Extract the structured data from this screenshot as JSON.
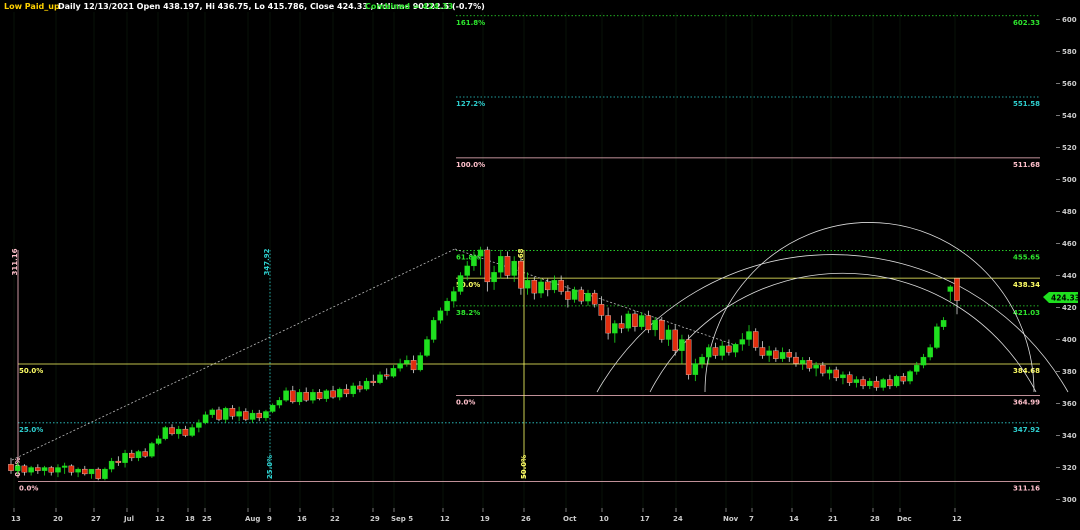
{
  "header": {
    "symbol": "Low Paid_up",
    "info": "Daily 12/13/2021 Open 438.197, Hi 436.75, Lo 415.786, Close 424.33 , Volume 90222.5 (-0.7%)",
    "combined": "Combined = 424.33"
  },
  "colors": {
    "background": "#000000",
    "up_candle": "#1fe01f",
    "down_candle": "#e02e0e",
    "last_price_tag": "#1fe01f"
  },
  "chart_data": {
    "type": "candlestick",
    "title": "",
    "ylim": [
      290,
      610
    ],
    "y_ticks": [
      300,
      320,
      340,
      360,
      380,
      400,
      420,
      440,
      460,
      480,
      500,
      520,
      540,
      560,
      580,
      600
    ],
    "x_ticks": [
      "13",
      "20",
      "27",
      "Jul",
      "12",
      "18",
      "25",
      "Aug",
      "9",
      "16",
      "22",
      "29",
      "Sep 5",
      "12",
      "19",
      "26",
      "Oct",
      "10",
      "17",
      "24",
      "Nov",
      "7",
      "14",
      "21",
      "28",
      "Dec",
      "12"
    ],
    "last_price": "424.33",
    "levels_right": [
      {
        "pct": "161.8%",
        "value": "602.33",
        "price": 602.33,
        "style": "dotted",
        "color": "#2ee62e"
      },
      {
        "pct": "127.2%",
        "value": "551.58",
        "price": 551.58,
        "style": "dotted",
        "color": "#2ecfcf"
      },
      {
        "pct": "100.0%",
        "value": "511.68",
        "price": 513.5,
        "style": "solid",
        "color": "#ffc0cb"
      },
      {
        "pct": "61.8%",
        "value": "455.65",
        "price": 455.65,
        "style": "dotted",
        "color": "#2ee62e"
      },
      {
        "pct": "50.0%",
        "value": "438.34",
        "price": 438.34,
        "style": "solid",
        "color": "#ffff66"
      },
      {
        "pct": "38.2%",
        "value": "421.03",
        "price": 421.03,
        "style": "dotted",
        "color": "#2ee62e"
      },
      {
        "pct": "0.0%",
        "value": "364.99",
        "price": 364.99,
        "style": "solid",
        "color": "#ffc0cb"
      }
    ],
    "levels_left": [
      {
        "pct": "50.0%",
        "price": 384.68,
        "style": "solid",
        "color": "#ffff66"
      },
      {
        "pct": "25.0%",
        "price": 347.92,
        "style": "dotted",
        "color": "#2ecfcf"
      },
      {
        "pct": "0.0%",
        "price": 311.16,
        "style": "solid",
        "color": "#ffc0cb"
      }
    ],
    "right_levels_extra": [
      {
        "value": "384.68",
        "price": 384.68,
        "color": "#ffff66"
      },
      {
        "value": "347.92",
        "price": 347.92,
        "color": "#2ecfcf"
      },
      {
        "value": "311.16",
        "price": 311.16,
        "color": "#ffc0cb"
      }
    ],
    "vertical_markers": [
      {
        "label": "311.16",
        "date": "13",
        "color": "#ffc0cb",
        "bottom_label": "0.0%"
      },
      {
        "label": "347.92",
        "date": "9",
        "color": "#2ecfcf",
        "bottom_label": "25.0%"
      },
      {
        "label": "384.68",
        "date": "26",
        "color": "#ffff66",
        "bottom_label": "50.0%"
      }
    ],
    "candles": [
      {
        "o": 322,
        "h": 326,
        "l": 316,
        "c": 318
      },
      {
        "o": 318,
        "h": 323,
        "l": 316,
        "c": 321
      },
      {
        "o": 321,
        "h": 322,
        "l": 315,
        "c": 317
      },
      {
        "o": 317,
        "h": 321,
        "l": 315,
        "c": 320
      },
      {
        "o": 320,
        "h": 322,
        "l": 316,
        "c": 318
      },
      {
        "o": 318,
        "h": 321,
        "l": 315,
        "c": 320
      },
      {
        "o": 320,
        "h": 321,
        "l": 315,
        "c": 317
      },
      {
        "o": 317,
        "h": 322,
        "l": 314,
        "c": 320
      },
      {
        "o": 320,
        "h": 323,
        "l": 316,
        "c": 321
      },
      {
        "o": 321,
        "h": 322,
        "l": 315,
        "c": 317
      },
      {
        "o": 317,
        "h": 320,
        "l": 314,
        "c": 319
      },
      {
        "o": 319,
        "h": 321,
        "l": 315,
        "c": 316
      },
      {
        "o": 316,
        "h": 319,
        "l": 313,
        "c": 319
      },
      {
        "o": 319,
        "h": 320,
        "l": 312,
        "c": 313
      },
      {
        "o": 313,
        "h": 320,
        "l": 312,
        "c": 319
      },
      {
        "o": 319,
        "h": 326,
        "l": 317,
        "c": 324
      },
      {
        "o": 324,
        "h": 327,
        "l": 321,
        "c": 323
      },
      {
        "o": 323,
        "h": 331,
        "l": 320,
        "c": 329
      },
      {
        "o": 329,
        "h": 331,
        "l": 324,
        "c": 326
      },
      {
        "o": 326,
        "h": 331,
        "l": 324,
        "c": 330
      },
      {
        "o": 330,
        "h": 332,
        "l": 326,
        "c": 327
      },
      {
        "o": 327,
        "h": 336,
        "l": 326,
        "c": 335
      },
      {
        "o": 335,
        "h": 340,
        "l": 334,
        "c": 338
      },
      {
        "o": 338,
        "h": 346,
        "l": 337,
        "c": 345
      },
      {
        "o": 345,
        "h": 347,
        "l": 340,
        "c": 341
      },
      {
        "o": 341,
        "h": 346,
        "l": 338,
        "c": 344
      },
      {
        "o": 344,
        "h": 346,
        "l": 339,
        "c": 340
      },
      {
        "o": 340,
        "h": 347,
        "l": 339,
        "c": 345
      },
      {
        "o": 345,
        "h": 350,
        "l": 342,
        "c": 348
      },
      {
        "o": 348,
        "h": 355,
        "l": 347,
        "c": 353
      },
      {
        "o": 353,
        "h": 357,
        "l": 351,
        "c": 356
      },
      {
        "o": 356,
        "h": 358,
        "l": 349,
        "c": 350
      },
      {
        "o": 350,
        "h": 358,
        "l": 348,
        "c": 357
      },
      {
        "o": 357,
        "h": 359,
        "l": 350,
        "c": 352
      },
      {
        "o": 352,
        "h": 358,
        "l": 349,
        "c": 355
      },
      {
        "o": 355,
        "h": 357,
        "l": 349,
        "c": 350
      },
      {
        "o": 350,
        "h": 356,
        "l": 348,
        "c": 354
      },
      {
        "o": 354,
        "h": 356,
        "l": 349,
        "c": 351
      },
      {
        "o": 351,
        "h": 356,
        "l": 349,
        "c": 355
      },
      {
        "o": 355,
        "h": 360,
        "l": 354,
        "c": 359
      },
      {
        "o": 359,
        "h": 364,
        "l": 357,
        "c": 362
      },
      {
        "o": 362,
        "h": 370,
        "l": 361,
        "c": 368
      },
      {
        "o": 368,
        "h": 371,
        "l": 360,
        "c": 361
      },
      {
        "o": 361,
        "h": 369,
        "l": 359,
        "c": 367
      },
      {
        "o": 367,
        "h": 370,
        "l": 361,
        "c": 362
      },
      {
        "o": 362,
        "h": 369,
        "l": 360,
        "c": 367
      },
      {
        "o": 367,
        "h": 369,
        "l": 362,
        "c": 363
      },
      {
        "o": 363,
        "h": 369,
        "l": 361,
        "c": 368
      },
      {
        "o": 368,
        "h": 371,
        "l": 363,
        "c": 364
      },
      {
        "o": 364,
        "h": 370,
        "l": 362,
        "c": 369
      },
      {
        "o": 369,
        "h": 372,
        "l": 364,
        "c": 366
      },
      {
        "o": 366,
        "h": 373,
        "l": 364,
        "c": 371
      },
      {
        "o": 371,
        "h": 374,
        "l": 367,
        "c": 369
      },
      {
        "o": 369,
        "h": 376,
        "l": 368,
        "c": 374
      },
      {
        "o": 374,
        "h": 378,
        "l": 371,
        "c": 373
      },
      {
        "o": 373,
        "h": 380,
        "l": 372,
        "c": 378
      },
      {
        "o": 378,
        "h": 382,
        "l": 375,
        "c": 377
      },
      {
        "o": 377,
        "h": 384,
        "l": 376,
        "c": 382
      },
      {
        "o": 382,
        "h": 388,
        "l": 380,
        "c": 385
      },
      {
        "o": 385,
        "h": 390,
        "l": 383,
        "c": 387
      },
      {
        "o": 387,
        "h": 390,
        "l": 379,
        "c": 381
      },
      {
        "o": 381,
        "h": 392,
        "l": 380,
        "c": 390
      },
      {
        "o": 390,
        "h": 402,
        "l": 389,
        "c": 400
      },
      {
        "o": 400,
        "h": 414,
        "l": 398,
        "c": 412
      },
      {
        "o": 412,
        "h": 420,
        "l": 410,
        "c": 418
      },
      {
        "o": 418,
        "h": 426,
        "l": 415,
        "c": 424
      },
      {
        "o": 424,
        "h": 433,
        "l": 420,
        "c": 430
      },
      {
        "o": 430,
        "h": 442,
        "l": 428,
        "c": 440
      },
      {
        "o": 440,
        "h": 449,
        "l": 437,
        "c": 446
      },
      {
        "o": 446,
        "h": 455,
        "l": 443,
        "c": 452
      },
      {
        "o": 452,
        "h": 458,
        "l": 440,
        "c": 456
      },
      {
        "o": 456,
        "h": 458,
        "l": 430,
        "c": 436
      },
      {
        "o": 436,
        "h": 446,
        "l": 431,
        "c": 442
      },
      {
        "o": 442,
        "h": 456,
        "l": 438,
        "c": 452
      },
      {
        "o": 452,
        "h": 455,
        "l": 438,
        "c": 440
      },
      {
        "o": 440,
        "h": 452,
        "l": 436,
        "c": 449
      },
      {
        "o": 449,
        "h": 451,
        "l": 428,
        "c": 432
      },
      {
        "o": 432,
        "h": 442,
        "l": 428,
        "c": 437
      },
      {
        "o": 437,
        "h": 439,
        "l": 425,
        "c": 429
      },
      {
        "o": 429,
        "h": 438,
        "l": 426,
        "c": 436
      },
      {
        "o": 436,
        "h": 438,
        "l": 427,
        "c": 431
      },
      {
        "o": 431,
        "h": 440,
        "l": 429,
        "c": 437
      },
      {
        "o": 437,
        "h": 440,
        "l": 428,
        "c": 430
      },
      {
        "o": 430,
        "h": 434,
        "l": 420,
        "c": 425
      },
      {
        "o": 425,
        "h": 433,
        "l": 423,
        "c": 431
      },
      {
        "o": 431,
        "h": 433,
        "l": 422,
        "c": 424
      },
      {
        "o": 424,
        "h": 431,
        "l": 421,
        "c": 429
      },
      {
        "o": 429,
        "h": 431,
        "l": 420,
        "c": 422
      },
      {
        "o": 422,
        "h": 427,
        "l": 412,
        "c": 415
      },
      {
        "o": 415,
        "h": 420,
        "l": 400,
        "c": 404
      },
      {
        "o": 404,
        "h": 412,
        "l": 398,
        "c": 410
      },
      {
        "o": 410,
        "h": 415,
        "l": 404,
        "c": 407
      },
      {
        "o": 407,
        "h": 418,
        "l": 405,
        "c": 416
      },
      {
        "o": 416,
        "h": 418,
        "l": 405,
        "c": 408
      },
      {
        "o": 408,
        "h": 417,
        "l": 406,
        "c": 415
      },
      {
        "o": 415,
        "h": 418,
        "l": 404,
        "c": 406
      },
      {
        "o": 406,
        "h": 414,
        "l": 402,
        "c": 412
      },
      {
        "o": 412,
        "h": 414,
        "l": 398,
        "c": 400
      },
      {
        "o": 400,
        "h": 409,
        "l": 396,
        "c": 406
      },
      {
        "o": 406,
        "h": 409,
        "l": 390,
        "c": 393
      },
      {
        "o": 393,
        "h": 403,
        "l": 385,
        "c": 400
      },
      {
        "o": 400,
        "h": 403,
        "l": 375,
        "c": 378
      },
      {
        "o": 378,
        "h": 388,
        "l": 374,
        "c": 385
      },
      {
        "o": 385,
        "h": 391,
        "l": 382,
        "c": 389
      },
      {
        "o": 389,
        "h": 397,
        "l": 385,
        "c": 395
      },
      {
        "o": 395,
        "h": 398,
        "l": 388,
        "c": 390
      },
      {
        "o": 390,
        "h": 399,
        "l": 387,
        "c": 396
      },
      {
        "o": 396,
        "h": 400,
        "l": 390,
        "c": 392
      },
      {
        "o": 392,
        "h": 398,
        "l": 389,
        "c": 397
      },
      {
        "o": 397,
        "h": 404,
        "l": 393,
        "c": 400
      },
      {
        "o": 400,
        "h": 409,
        "l": 396,
        "c": 405
      },
      {
        "o": 405,
        "h": 407,
        "l": 393,
        "c": 395
      },
      {
        "o": 395,
        "h": 399,
        "l": 388,
        "c": 390
      },
      {
        "o": 390,
        "h": 396,
        "l": 386,
        "c": 393
      },
      {
        "o": 393,
        "h": 395,
        "l": 386,
        "c": 388
      },
      {
        "o": 388,
        "h": 395,
        "l": 386,
        "c": 392
      },
      {
        "o": 392,
        "h": 394,
        "l": 386,
        "c": 389
      },
      {
        "o": 389,
        "h": 392,
        "l": 383,
        "c": 385
      },
      {
        "o": 385,
        "h": 389,
        "l": 381,
        "c": 387
      },
      {
        "o": 387,
        "h": 389,
        "l": 380,
        "c": 382
      },
      {
        "o": 382,
        "h": 386,
        "l": 377,
        "c": 384
      },
      {
        "o": 384,
        "h": 386,
        "l": 377,
        "c": 379
      },
      {
        "o": 379,
        "h": 383,
        "l": 375,
        "c": 381
      },
      {
        "o": 381,
        "h": 383,
        "l": 374,
        "c": 376
      },
      {
        "o": 376,
        "h": 380,
        "l": 372,
        "c": 378
      },
      {
        "o": 378,
        "h": 380,
        "l": 371,
        "c": 373
      },
      {
        "o": 373,
        "h": 377,
        "l": 370,
        "c": 375
      },
      {
        "o": 375,
        "h": 377,
        "l": 369,
        "c": 371
      },
      {
        "o": 371,
        "h": 376,
        "l": 369,
        "c": 374
      },
      {
        "o": 374,
        "h": 377,
        "l": 368,
        "c": 370
      },
      {
        "o": 370,
        "h": 376,
        "l": 368,
        "c": 375
      },
      {
        "o": 375,
        "h": 378,
        "l": 369,
        "c": 371
      },
      {
        "o": 371,
        "h": 378,
        "l": 370,
        "c": 377
      },
      {
        "o": 377,
        "h": 379,
        "l": 372,
        "c": 374
      },
      {
        "o": 374,
        "h": 381,
        "l": 372,
        "c": 380
      },
      {
        "o": 380,
        "h": 386,
        "l": 378,
        "c": 384
      },
      {
        "o": 384,
        "h": 391,
        "l": 382,
        "c": 389
      },
      {
        "o": 389,
        "h": 397,
        "l": 387,
        "c": 395
      },
      {
        "o": 395,
        "h": 410,
        "l": 394,
        "c": 408
      },
      {
        "o": 408,
        "h": 414,
        "l": 406,
        "c": 412
      },
      {
        "o": 430,
        "h": 434,
        "l": 424,
        "c": 433
      },
      {
        "o": 438.197,
        "h": 436.75,
        "l": 415.786,
        "c": 424.33
      }
    ]
  }
}
